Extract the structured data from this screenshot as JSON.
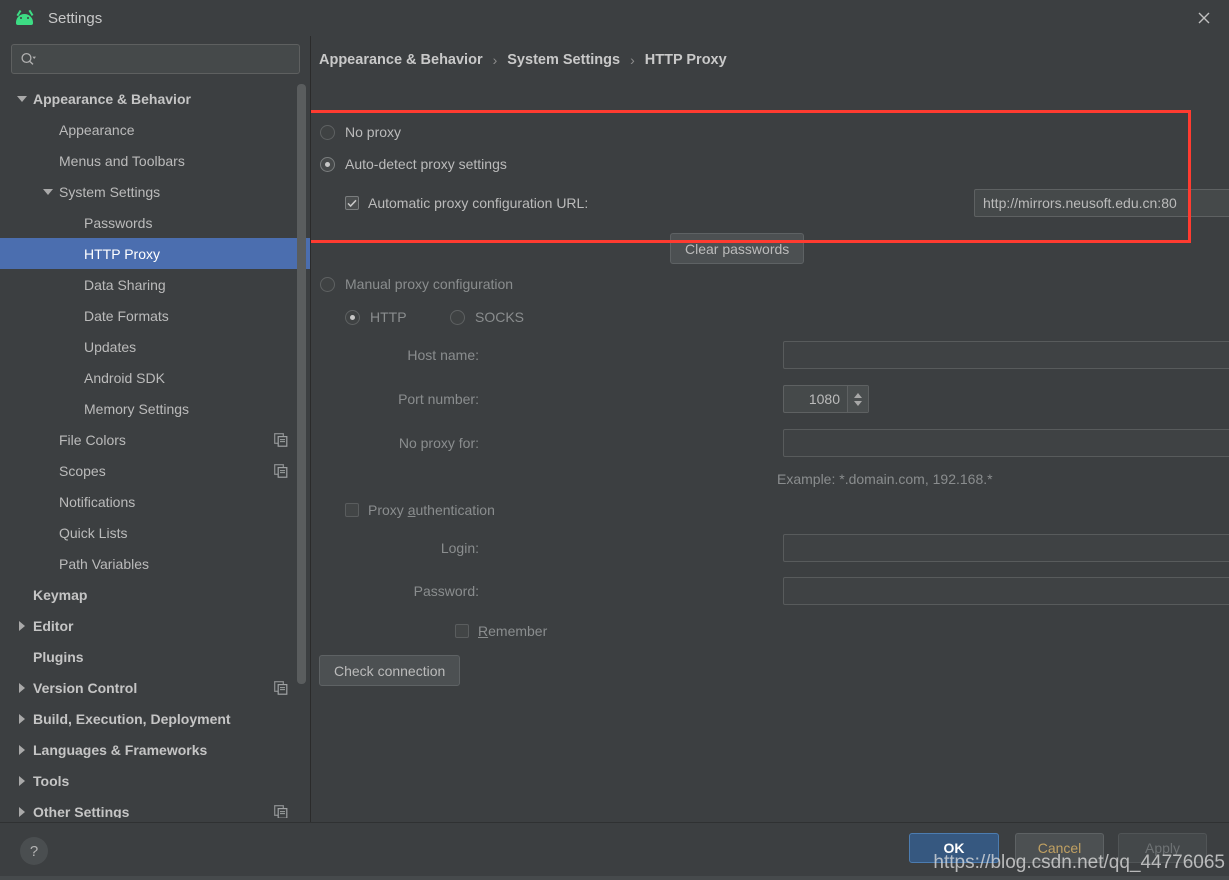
{
  "window": {
    "title": "Settings",
    "app_icon": "android-robot-icon",
    "close_icon": "close-icon"
  },
  "sidebar": {
    "search": {
      "placeholder": "",
      "value": "",
      "icon": "search-icon",
      "dropdown_icon": "chevron-down-icon"
    },
    "items": [
      {
        "label": "Appearance & Behavior",
        "indent": 0,
        "arrow": "down",
        "bold": true,
        "selected": false,
        "copy_icon": false
      },
      {
        "label": "Appearance",
        "indent": 1,
        "arrow": "none",
        "bold": false,
        "selected": false,
        "copy_icon": false
      },
      {
        "label": "Menus and Toolbars",
        "indent": 1,
        "arrow": "none",
        "bold": false,
        "selected": false,
        "copy_icon": false
      },
      {
        "label": "System Settings",
        "indent": 1,
        "arrow": "down",
        "bold": false,
        "selected": false,
        "copy_icon": false
      },
      {
        "label": "Passwords",
        "indent": 2,
        "arrow": "none",
        "bold": false,
        "selected": false,
        "copy_icon": false
      },
      {
        "label": "HTTP Proxy",
        "indent": 2,
        "arrow": "none",
        "bold": false,
        "selected": true,
        "copy_icon": false
      },
      {
        "label": "Data Sharing",
        "indent": 2,
        "arrow": "none",
        "bold": false,
        "selected": false,
        "copy_icon": false
      },
      {
        "label": "Date Formats",
        "indent": 2,
        "arrow": "none",
        "bold": false,
        "selected": false,
        "copy_icon": false
      },
      {
        "label": "Updates",
        "indent": 2,
        "arrow": "none",
        "bold": false,
        "selected": false,
        "copy_icon": false
      },
      {
        "label": "Android SDK",
        "indent": 2,
        "arrow": "none",
        "bold": false,
        "selected": false,
        "copy_icon": false
      },
      {
        "label": "Memory Settings",
        "indent": 2,
        "arrow": "none",
        "bold": false,
        "selected": false,
        "copy_icon": false
      },
      {
        "label": "File Colors",
        "indent": 1,
        "arrow": "none",
        "bold": false,
        "selected": false,
        "copy_icon": true
      },
      {
        "label": "Scopes",
        "indent": 1,
        "arrow": "none",
        "bold": false,
        "selected": false,
        "copy_icon": true
      },
      {
        "label": "Notifications",
        "indent": 1,
        "arrow": "none",
        "bold": false,
        "selected": false,
        "copy_icon": false
      },
      {
        "label": "Quick Lists",
        "indent": 1,
        "arrow": "none",
        "bold": false,
        "selected": false,
        "copy_icon": false
      },
      {
        "label": "Path Variables",
        "indent": 1,
        "arrow": "none",
        "bold": false,
        "selected": false,
        "copy_icon": false
      },
      {
        "label": "Keymap",
        "indent": 0,
        "arrow": "none",
        "bold": true,
        "selected": false,
        "copy_icon": false
      },
      {
        "label": "Editor",
        "indent": 0,
        "arrow": "right",
        "bold": true,
        "selected": false,
        "copy_icon": false
      },
      {
        "label": "Plugins",
        "indent": 0,
        "arrow": "none",
        "bold": true,
        "selected": false,
        "copy_icon": false
      },
      {
        "label": "Version Control",
        "indent": 0,
        "arrow": "right",
        "bold": true,
        "selected": false,
        "copy_icon": true
      },
      {
        "label": "Build, Execution, Deployment",
        "indent": 0,
        "arrow": "right",
        "bold": true,
        "selected": false,
        "copy_icon": false
      },
      {
        "label": "Languages & Frameworks",
        "indent": 0,
        "arrow": "right",
        "bold": true,
        "selected": false,
        "copy_icon": false
      },
      {
        "label": "Tools",
        "indent": 0,
        "arrow": "right",
        "bold": true,
        "selected": false,
        "copy_icon": false
      },
      {
        "label": "Other Settings",
        "indent": 0,
        "arrow": "right",
        "bold": true,
        "selected": false,
        "copy_icon": true
      }
    ]
  },
  "breadcrumb": {
    "crumb1": "Appearance & Behavior",
    "sep1": "›",
    "crumb2": "System Settings",
    "sep2": "›",
    "crumb3": "HTTP Proxy"
  },
  "proxy": {
    "no_proxy_label": "No proxy",
    "auto_detect_label": "Auto-detect proxy settings",
    "auto_config_url_label": "Automatic proxy configuration URL:",
    "auto_config_url_value": "http://mirrors.neusoft.edu.cn:80",
    "clear_passwords_label": "Clear passwords",
    "manual_label": "Manual proxy configuration",
    "http_label": "HTTP",
    "socks_label": "SOCKS",
    "host_name_label": "Host name:",
    "host_name_value": "",
    "port_number_label": "Port number:",
    "port_number_value": "1080",
    "no_proxy_for_label": "No proxy for:",
    "no_proxy_for_value": "",
    "example_text": "Example: *.domain.com, 192.168.*",
    "proxy_auth_label_pre": "Proxy ",
    "proxy_auth_label_mnemonic": "a",
    "proxy_auth_label_post": "uthentication",
    "login_label": "Login:",
    "login_value": "",
    "password_label": "Password:",
    "password_value": "",
    "remember_label_mnemonic": "R",
    "remember_label_post": "emember",
    "check_connection_label": "Check connection",
    "expand_icon": "expand-icon",
    "selected_mode": "auto-detect",
    "selected_manual_protocol": "HTTP",
    "highlight_color": "#ff3b30"
  },
  "footer": {
    "help_label": "?",
    "ok_label": "OK",
    "cancel_label": "Cancel",
    "apply_label": "Apply",
    "watermark": "https://blog.csdn.net/qq_44776065"
  }
}
